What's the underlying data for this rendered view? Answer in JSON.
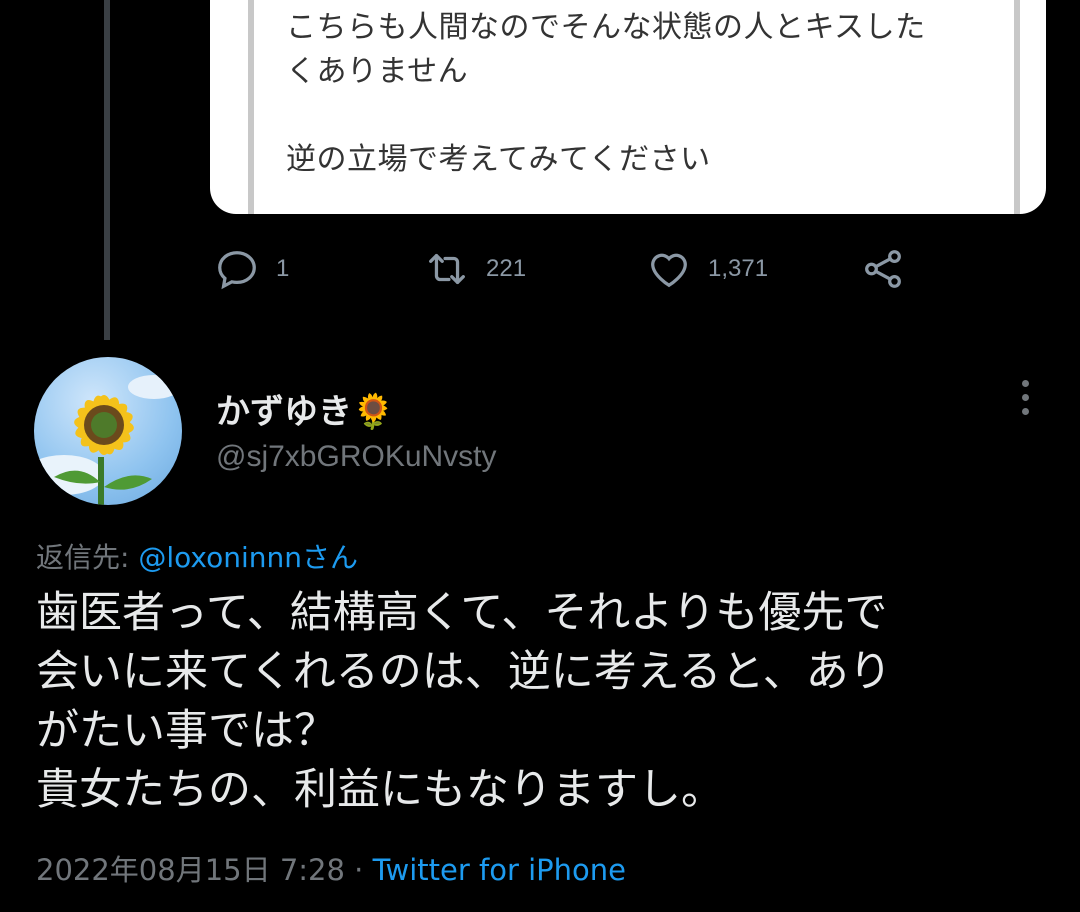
{
  "quoted_tweet": {
    "text": "こちらも人間なのでそんな状態の人とキスした\nくありません\n\n逆の立場で考えてみてください"
  },
  "actions": {
    "reply_count": "1",
    "retweet_count": "221",
    "like_count": "1,371",
    "icons": [
      "reply-icon",
      "retweet-icon",
      "like-icon",
      "share-icon"
    ]
  },
  "tweet": {
    "display_name": "かずゆき🌻",
    "handle": "@sj7xbGROKuNvsty",
    "reply_prefix": "返信先: ",
    "reply_to": "@loxoninnnさん",
    "text": "歯医者って、結構高くて、それよりも優先で\n会いに来てくれるのは、逆に考えると、あり\nがたい事では？\n貴女たちの、利益にもなりますし。",
    "timestamp": "2022年08月15日 7:28",
    "separator": " · ",
    "source": "Twitter for iPhone"
  },
  "colors": {
    "background": "#000000",
    "text": "#e7e9ea",
    "secondary": "#71767b",
    "link": "#1d9bf0"
  }
}
